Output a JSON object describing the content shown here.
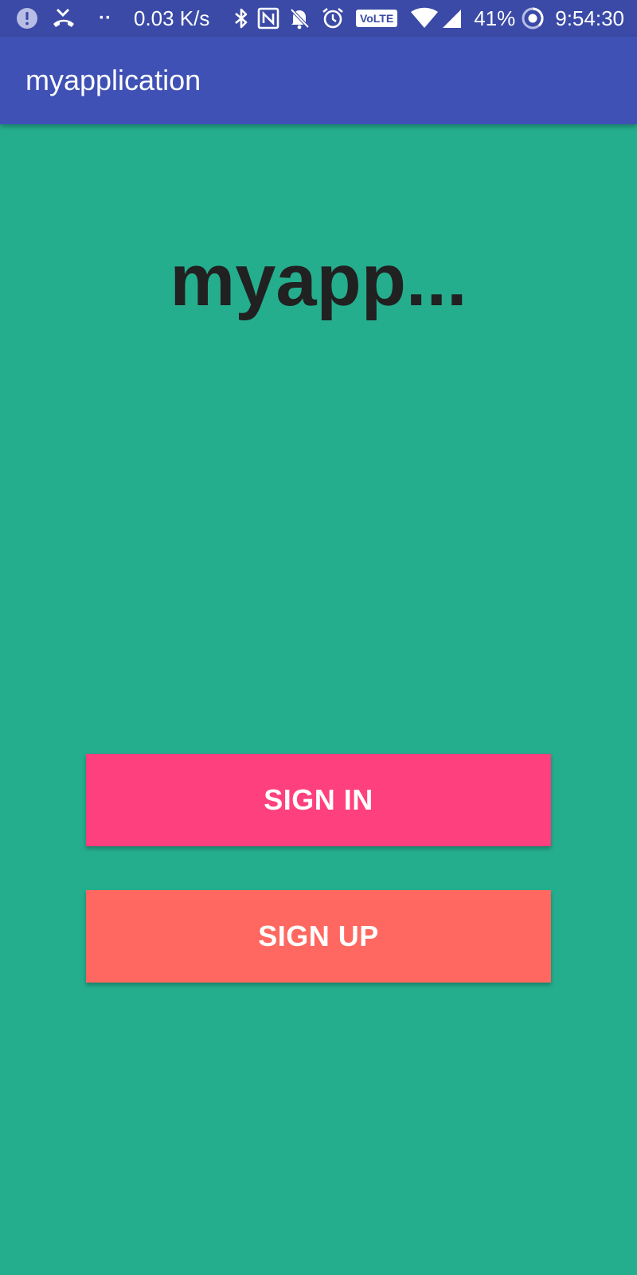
{
  "status_bar": {
    "network_speed": "0.03 K/s",
    "volte_badge": "VoLTE",
    "battery_percent": "41%",
    "time": "9:54:30",
    "dots": "··",
    "icons": [
      "alert-icon",
      "missed-call-icon",
      "bluetooth-icon",
      "nfc-icon",
      "notifications-off-icon",
      "alarm-icon",
      "volte-icon",
      "wifi-icon",
      "cell-signal-icon",
      "battery-icon"
    ]
  },
  "app_bar": {
    "title": "myapplication",
    "color": "#3F51B5"
  },
  "main": {
    "hero_title": "myapp...",
    "background": "#25AE8E"
  },
  "buttons": {
    "sign_in_label": "SIGN IN",
    "sign_in_color": "#FF407F",
    "sign_up_label": "SIGN UP",
    "sign_up_color": "#FF6861"
  }
}
